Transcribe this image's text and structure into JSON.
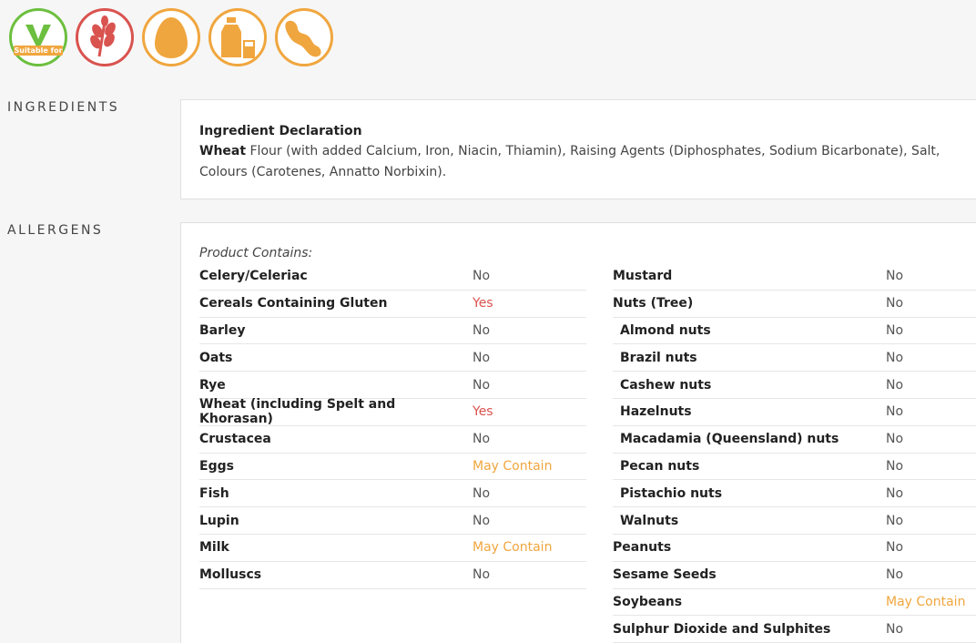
{
  "icons": [
    {
      "name": "vegetarian",
      "badge": "Suitable for",
      "color": "#6cbf3f"
    },
    {
      "name": "gluten",
      "color": "#d9534f"
    },
    {
      "name": "egg",
      "color": "#f0a63e"
    },
    {
      "name": "milk",
      "color": "#f0a63e"
    },
    {
      "name": "soya",
      "color": "#f0a63e"
    }
  ],
  "ingredients": {
    "label": "INGREDIENTS",
    "title": "Ingredient Declaration",
    "bold_word": "Wheat",
    "text": " Flour (with added Calcium, Iron, Niacin, Thiamin), Raising Agents (Diphosphates, Sodium Bicarbonate), Salt, Colours (Carotenes, Annatto Norbixin)."
  },
  "allergens": {
    "label": "ALLERGENS",
    "contains_label": "Product Contains:",
    "left": [
      {
        "name": "Celery/Celeriac",
        "value": "No"
      },
      {
        "name": "Cereals Containing Gluten",
        "value": "Yes"
      },
      {
        "name": "Barley",
        "value": "No"
      },
      {
        "name": "Oats",
        "value": "No"
      },
      {
        "name": "Rye",
        "value": "No"
      },
      {
        "name": "Wheat (including Spelt and Khorasan)",
        "value": "Yes"
      },
      {
        "name": "Crustacea",
        "value": "No"
      },
      {
        "name": "Eggs",
        "value": "May Contain"
      },
      {
        "name": "Fish",
        "value": "No"
      },
      {
        "name": "Lupin",
        "value": "No"
      },
      {
        "name": "Milk",
        "value": "May Contain"
      },
      {
        "name": "Molluscs",
        "value": "No"
      }
    ],
    "right": [
      {
        "name": "Mustard",
        "value": "No"
      },
      {
        "name": "Nuts (Tree)",
        "value": "No"
      },
      {
        "name": "Almond nuts",
        "value": "No",
        "sub": true
      },
      {
        "name": "Brazil nuts",
        "value": "No",
        "sub": true
      },
      {
        "name": "Cashew nuts",
        "value": "No",
        "sub": true
      },
      {
        "name": "Hazelnuts",
        "value": "No",
        "sub": true
      },
      {
        "name": "Macadamia (Queensland) nuts",
        "value": "No",
        "sub": true
      },
      {
        "name": "Pecan nuts",
        "value": "No",
        "sub": true
      },
      {
        "name": "Pistachio nuts",
        "value": "No",
        "sub": true
      },
      {
        "name": "Walnuts",
        "value": "No",
        "sub": true
      },
      {
        "name": "Peanuts",
        "value": "No"
      },
      {
        "name": "Sesame Seeds",
        "value": "No"
      },
      {
        "name": "Soybeans",
        "value": "May Contain"
      },
      {
        "name": "Sulphur Dioxide and Sulphites",
        "value": "No"
      }
    ]
  }
}
